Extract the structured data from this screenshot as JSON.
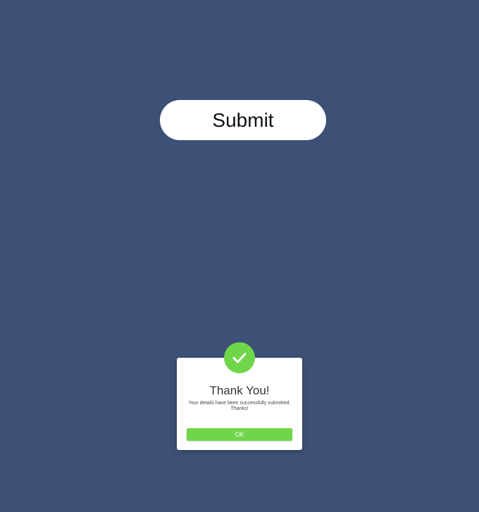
{
  "main": {
    "submit_label": "Submit"
  },
  "popup": {
    "icon": "checkmark-icon",
    "title": "Thank You!",
    "message": "Your details have been successfully submitted. Thanks!",
    "ok_label": "OK"
  },
  "colors": {
    "background": "#3d5075",
    "success": "#6fd649",
    "card": "#ffffff"
  }
}
